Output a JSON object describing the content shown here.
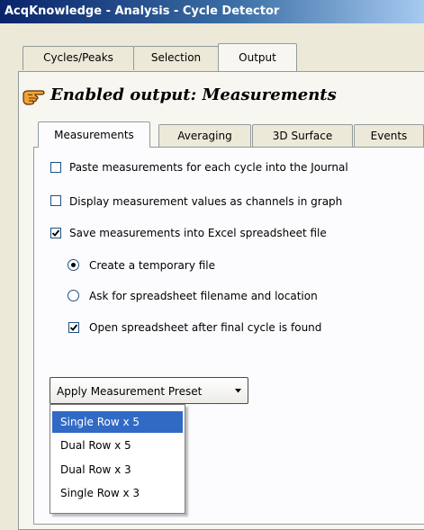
{
  "window": {
    "title": "AcqKnowledge - Analysis - Cycle Detector"
  },
  "outer_tabs": [
    {
      "label": "Cycles/Peaks",
      "active": false
    },
    {
      "label": "Selection",
      "active": false
    },
    {
      "label": "Output",
      "active": true
    }
  ],
  "heading": {
    "text": "Enabled output: Measurements",
    "icon": "pointing-hand-icon"
  },
  "inner_tabs": [
    {
      "label": "Measurements",
      "active": true
    },
    {
      "label": "Averaging",
      "active": false
    },
    {
      "label": "3D Surface",
      "active": false
    },
    {
      "label": "Events",
      "active": false
    }
  ],
  "options": {
    "paste_journal": {
      "label": "Paste measurements for each cycle into the Journal",
      "checked": false
    },
    "display_channels": {
      "label": "Display measurement values as channels in graph",
      "checked": false
    },
    "save_excel": {
      "label": "Save measurements into Excel spreadsheet file",
      "checked": true
    },
    "temp_file": {
      "label": "Create a temporary file",
      "selected": true
    },
    "ask_filename": {
      "label": "Ask for spreadsheet filename and location",
      "selected": false
    },
    "open_after": {
      "label": "Open spreadsheet after final cycle is found",
      "checked": true
    }
  },
  "preset": {
    "button_label": "Apply Measurement Preset",
    "items": [
      {
        "label": "Single Row x 5",
        "highlighted": true
      },
      {
        "label": "Dual Row x 5",
        "highlighted": false
      },
      {
        "label": "Dual Row x 3",
        "highlighted": false
      },
      {
        "label": "Single Row x 3",
        "highlighted": false
      }
    ]
  },
  "colors": {
    "menu_highlight": "#316ac5",
    "title_bar": "#0a246a",
    "border": "#919b9c"
  }
}
